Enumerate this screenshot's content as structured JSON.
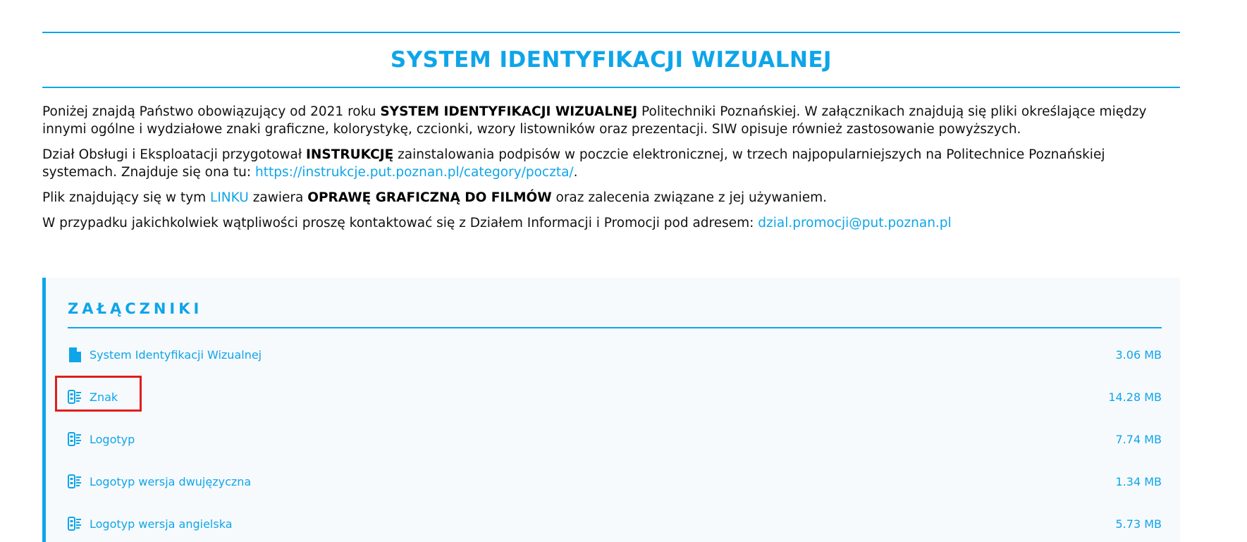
{
  "title": "SYSTEM IDENTYFIKACJI WIZUALNEJ",
  "intro": {
    "p1": {
      "before": "Poniżej znajdą Państwo obowiązujący od 2021 roku ",
      "bold": "SYSTEM IDENTYFIKACJI WIZUALNEJ",
      "after": " Politechniki Poznańskiej. W załącznikach znajdują się pliki określające między innymi ogólne i wydziałowe znaki graficzne, kolorystykę, czcionki, wzory listowników oraz prezentacji. SIW opisuje również zastosowanie powyższych."
    },
    "p2": {
      "before": "Dział Obsługi i Eksploatacji przygotował ",
      "bold": "INSTRUKCJĘ",
      "middle": " zainstalowania podpisów w poczcie elektronicznej, w trzech najpopularniejszych na Politechnice Poznańskiej systemach. Znajduje się ona tu: ",
      "link": "https://instrukcje.put.poznan.pl/category/poczta/",
      "after": "."
    },
    "p3": {
      "before": "Plik znajdujący się w tym ",
      "link": "LINKU",
      "middle": " zawiera ",
      "bold": "OPRAWĘ GRAFICZNĄ DO FILMÓW",
      "after": " oraz zalecenia związane z jej używaniem."
    },
    "p4": {
      "before": "W przypadku jakichkolwiek wątpliwości proszę kontaktować się z Działem Informacji i Promocji pod adresem: ",
      "link": "dzial.promocji@put.poznan.pl"
    }
  },
  "attachments": {
    "heading": "ZAŁĄCZNIKI",
    "items": [
      {
        "name": "System Identyfikacji Wizualnej",
        "size": "3.06 MB",
        "icon": "file-icon"
      },
      {
        "name": "Znak",
        "size": "14.28 MB",
        "icon": "archive-icon"
      },
      {
        "name": "Logotyp",
        "size": "7.74 MB",
        "icon": "archive-icon"
      },
      {
        "name": "Logotyp wersja dwujęzyczna",
        "size": "1.34 MB",
        "icon": "archive-icon"
      },
      {
        "name": "Logotyp wersja angielska",
        "size": "5.73 MB",
        "icon": "archive-icon"
      }
    ]
  },
  "colors": {
    "accent": "#0ea5e9",
    "panel_bg": "#f7fafd",
    "highlight": "#e11d1d"
  }
}
